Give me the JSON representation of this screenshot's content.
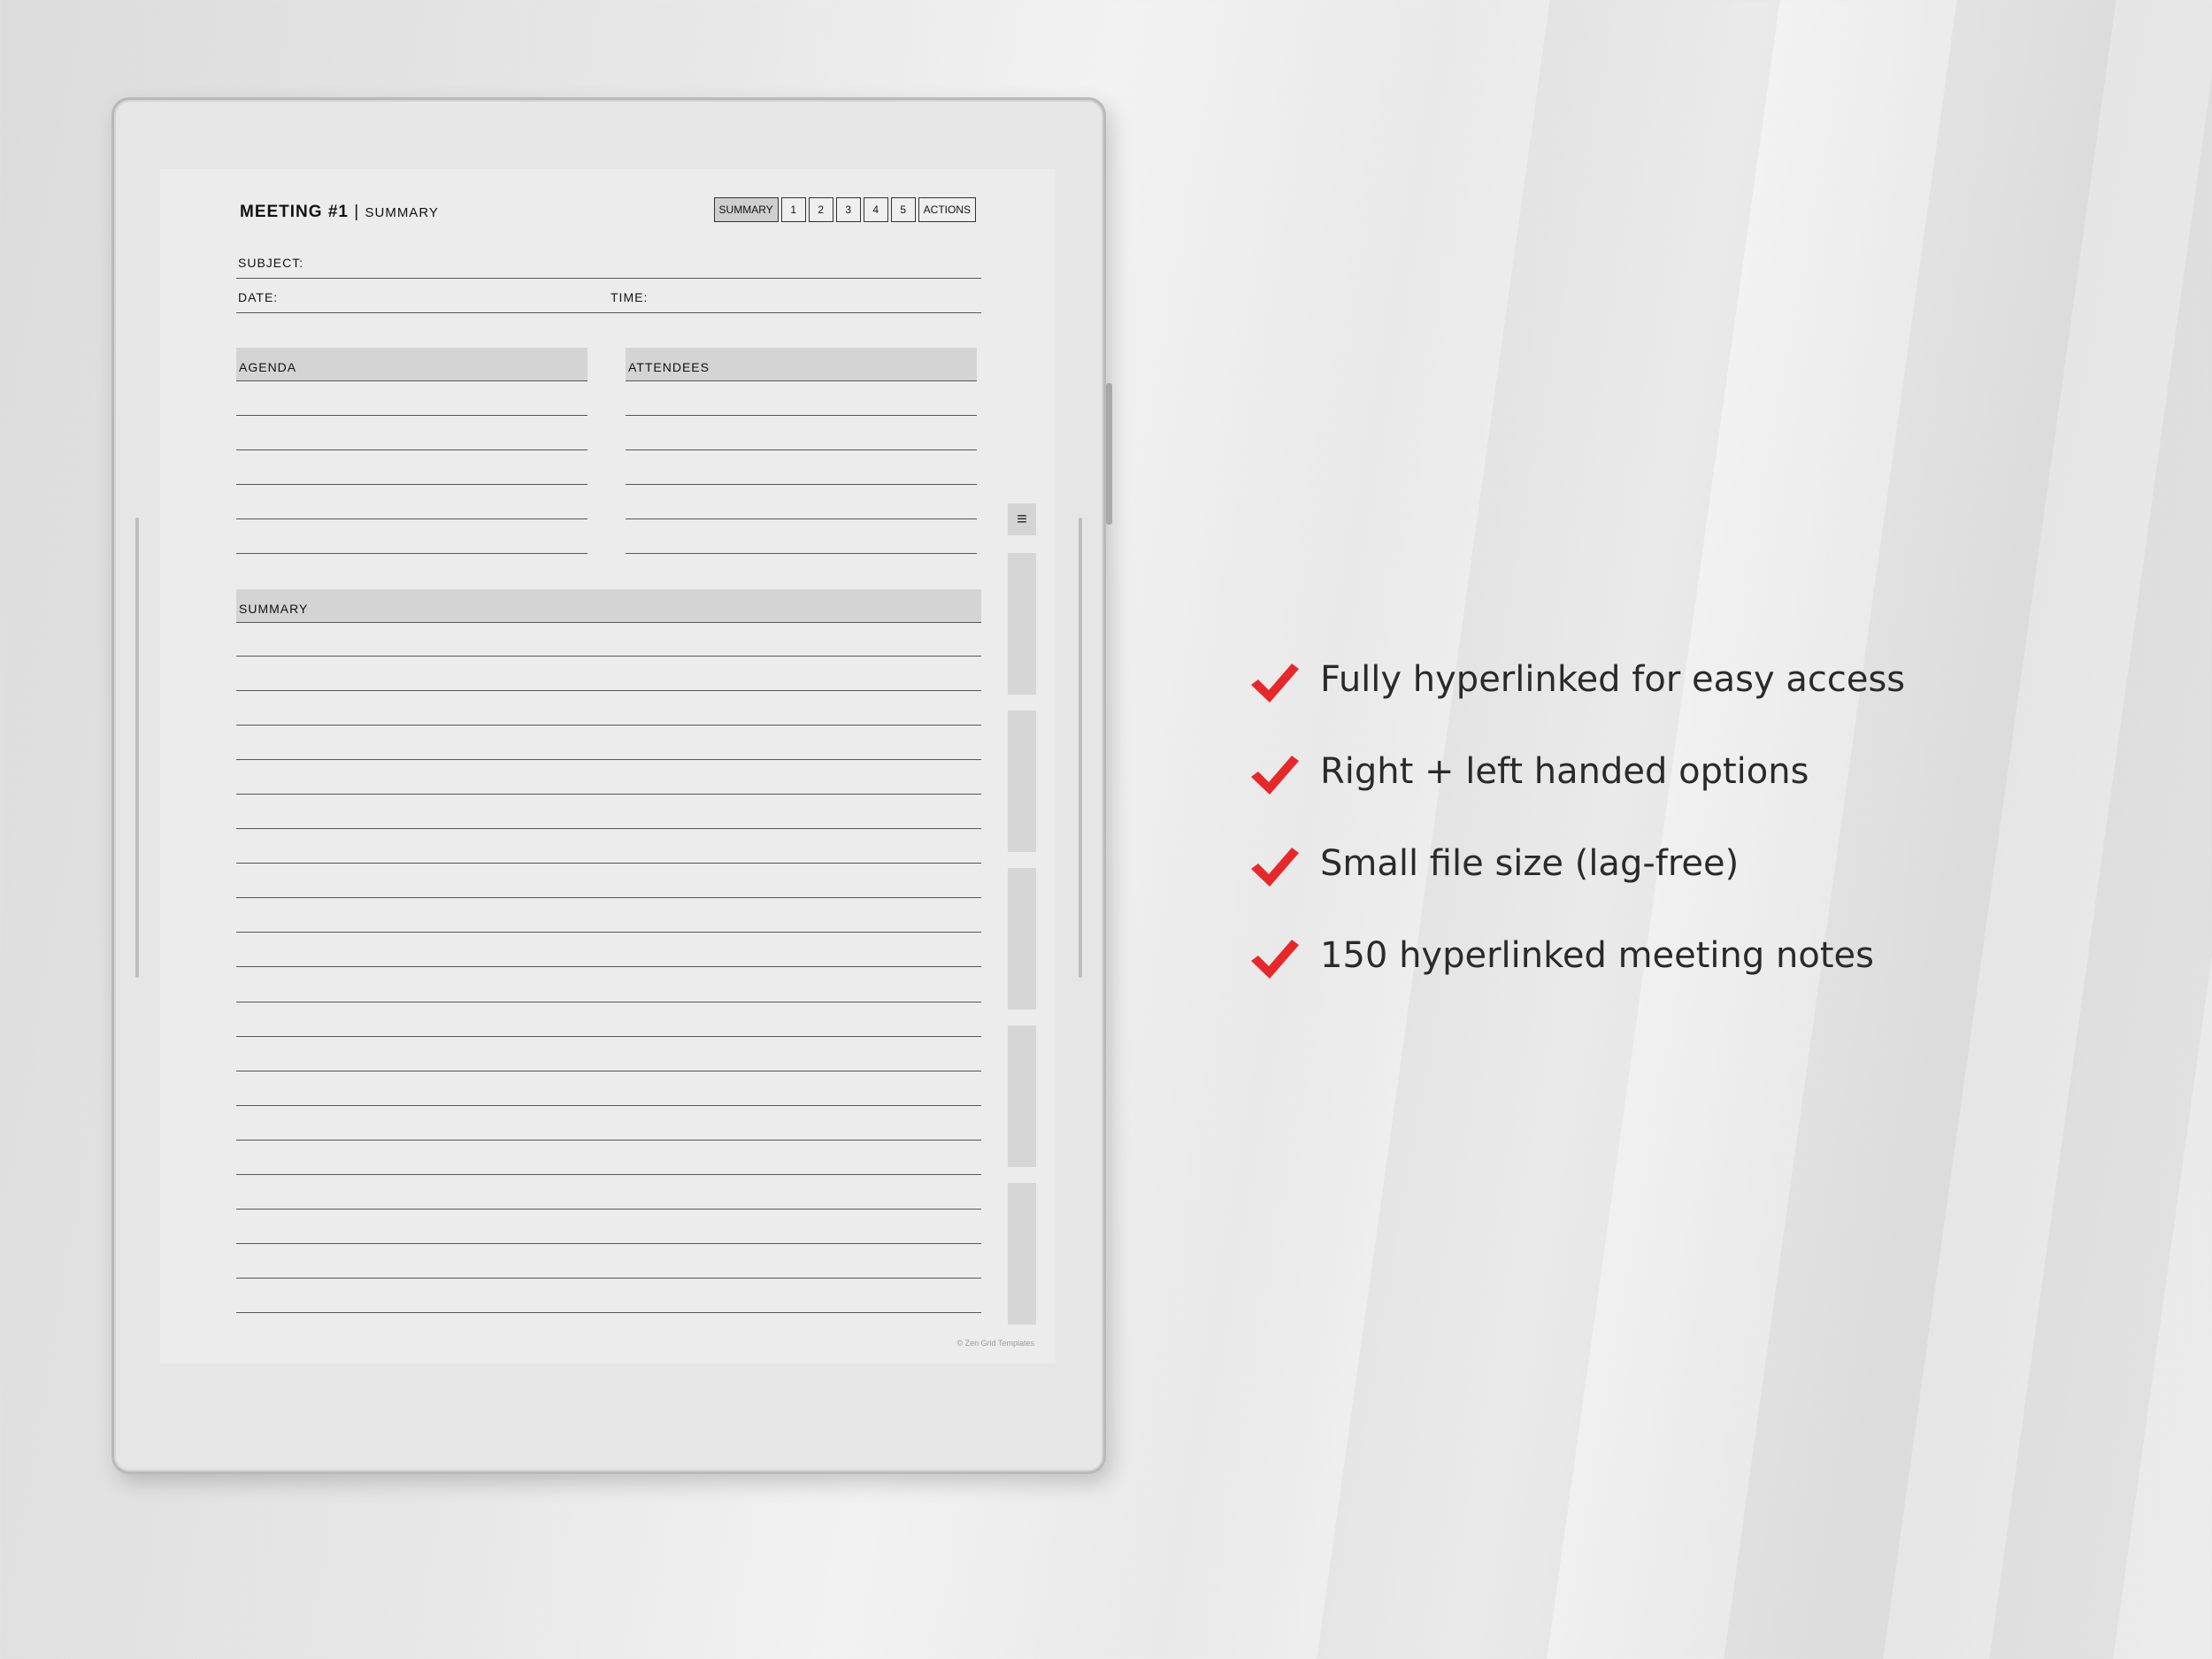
{
  "page": {
    "title_strong": "MEETING #1",
    "title_sep": "|",
    "title_sub": "SUMMARY",
    "copyright": "© Zen Grid Templates"
  },
  "nav": {
    "tabs": [
      {
        "label": "SUMMARY",
        "active": true
      },
      {
        "label": "1"
      },
      {
        "label": "2"
      },
      {
        "label": "3"
      },
      {
        "label": "4"
      },
      {
        "label": "5"
      },
      {
        "label": "ACTIONS"
      }
    ]
  },
  "fields": {
    "subject": "SUBJECT:",
    "date": "DATE:",
    "time": "TIME:"
  },
  "sections": {
    "agenda": "AGENDA",
    "attendees": "ATTENDEES",
    "summary": "SUMMARY"
  },
  "side_menu": {
    "icon": "menu-icon",
    "glyph": "≡"
  },
  "features": [
    {
      "text": "Fully hyperlinked for easy access",
      "icon": "checkmark-icon"
    },
    {
      "text": "Right + left handed options",
      "icon": "checkmark-icon"
    },
    {
      "text": "Small file size (lag-free)",
      "icon": "checkmark-icon"
    },
    {
      "text": "150 hyperlinked meeting notes",
      "icon": "checkmark-icon"
    }
  ],
  "colors": {
    "check": "#e8272a",
    "section_fill": "#d4d4d4",
    "screen": "#ececec"
  }
}
